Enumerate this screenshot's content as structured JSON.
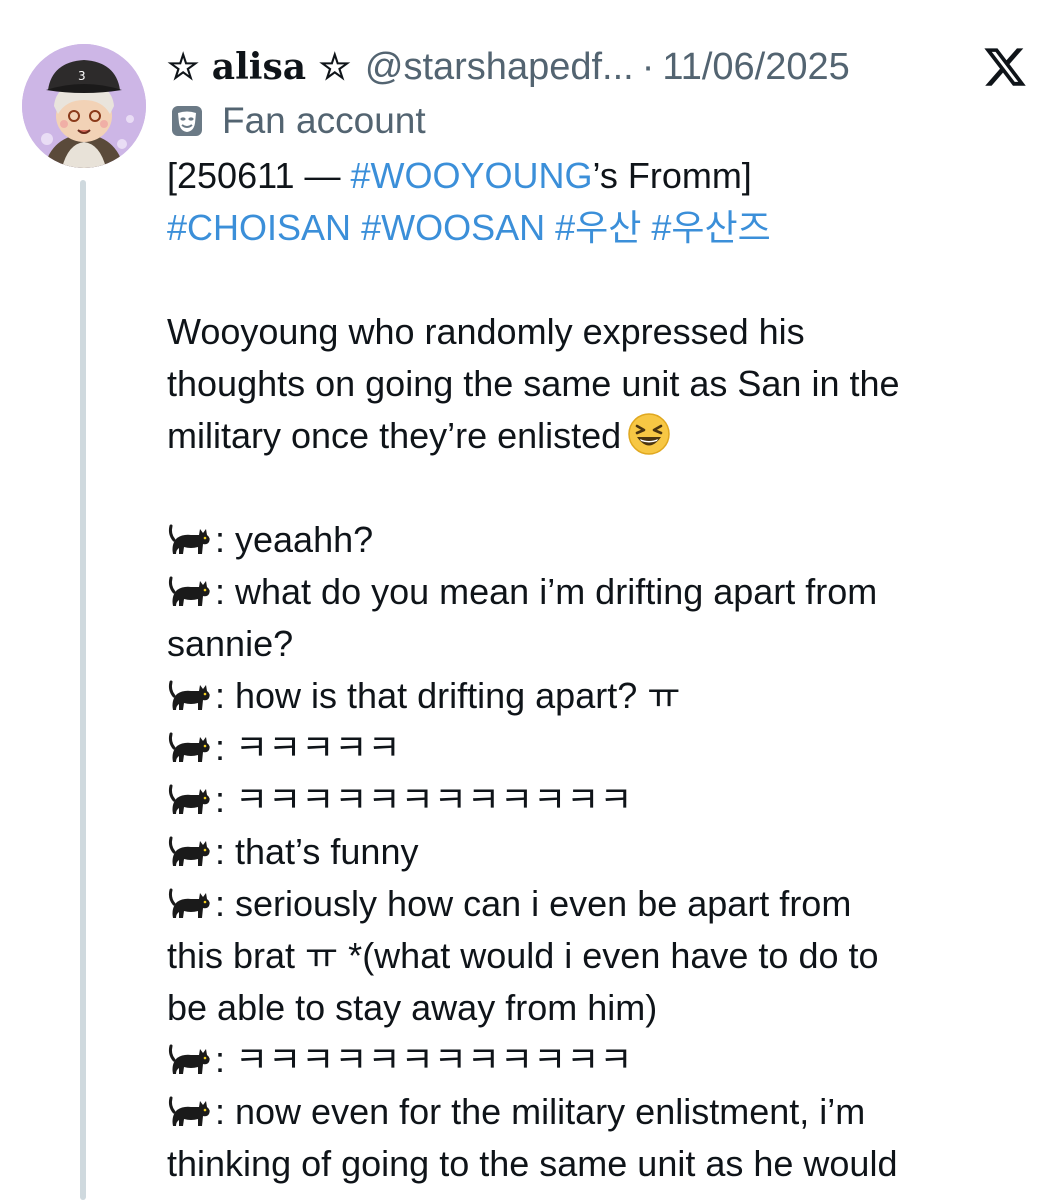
{
  "author": {
    "display_name": "☆ alisa ☆",
    "handle": "@starshapedf...",
    "separator": "·",
    "timestamp": "11/06/2025",
    "badge_icon": "theater-masks-icon",
    "badge_text": "Fan account"
  },
  "platform_icon": "x-logo-icon",
  "tweet": {
    "line1_prefix": "[250611 — ",
    "line1_tag": "#WOOYOUNG",
    "line1_suffix": "’s Fromm]",
    "hashtags": [
      "#CHOISAN",
      "#WOOSAN",
      "#우산",
      "#우산즈"
    ],
    "intro_lines": [
      "Wooyoung who randomly expressed his",
      "thoughts on going the same unit as San in the",
      "military once they’re enlisted"
    ],
    "intro_emoji": "grinning-squinting-face-icon",
    "speaker_icon": "black-cat-icon",
    "dialogue": [
      {
        "speaker": true,
        "text": ": yeaahh?"
      },
      {
        "speaker": true,
        "text": ": what do you mean i’m drifting apart from"
      },
      {
        "speaker": false,
        "text": "sannie?"
      },
      {
        "speaker": true,
        "text": ": how is that drifting apart? ㅠ"
      },
      {
        "speaker": true,
        "text": ": ㅋㅋㅋㅋㅋ"
      },
      {
        "speaker": true,
        "text": ": ㅋㅋㅋㅋㅋㅋㅋㅋㅋㅋㅋㅋ"
      },
      {
        "speaker": true,
        "text": ": that’s funny"
      },
      {
        "speaker": true,
        "text": ": seriously how can i even be apart from"
      },
      {
        "speaker": false,
        "text": "this brat ㅠ *(what would i even have to do to"
      },
      {
        "speaker": false,
        "text": "be able to stay away from him)"
      },
      {
        "speaker": true,
        "text": ": ㅋㅋㅋㅋㅋㅋㅋㅋㅋㅋㅋㅋ"
      },
      {
        "speaker": true,
        "text": ": now even for the military enlistment, i’m"
      },
      {
        "speaker": false,
        "text": "thinking of going to the same unit as he would"
      }
    ]
  }
}
